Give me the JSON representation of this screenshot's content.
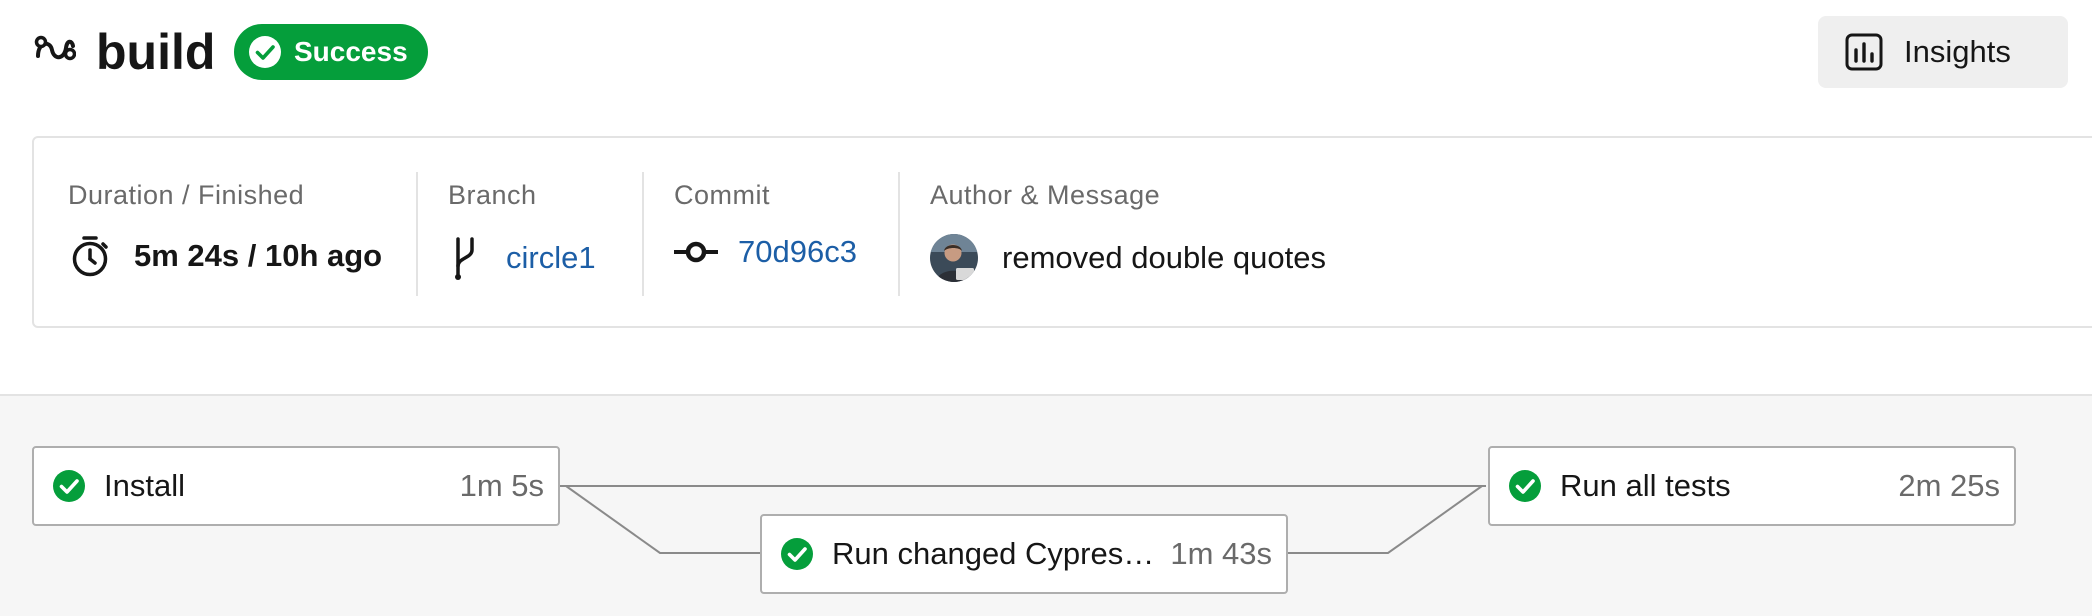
{
  "header": {
    "title": "build",
    "status": "Success",
    "insights_label": "Insights",
    "icon": "workflow-icon"
  },
  "info": {
    "duration": {
      "label": "Duration / Finished",
      "value": "5m 24s / 10h ago",
      "icon": "stopwatch-icon"
    },
    "branch": {
      "label": "Branch",
      "value": "circle1",
      "icon": "branch-icon"
    },
    "commit": {
      "label": "Commit",
      "value": "70d96c3",
      "icon": "commit-icon"
    },
    "author": {
      "label": "Author & Message",
      "message": "removed double quotes",
      "icon": "avatar"
    }
  },
  "jobs": [
    {
      "name": "Install",
      "duration": "1m 5s",
      "status": "success"
    },
    {
      "name": "Run changed Cypress...",
      "duration": "1m 43s",
      "status": "success"
    },
    {
      "name": "Run all tests",
      "duration": "2m 25s",
      "status": "success"
    }
  ],
  "colors": {
    "success": "#059e3b",
    "link": "#1c5ea6",
    "muted": "#6a6a6a",
    "graph_bg": "#f6f6f6"
  }
}
